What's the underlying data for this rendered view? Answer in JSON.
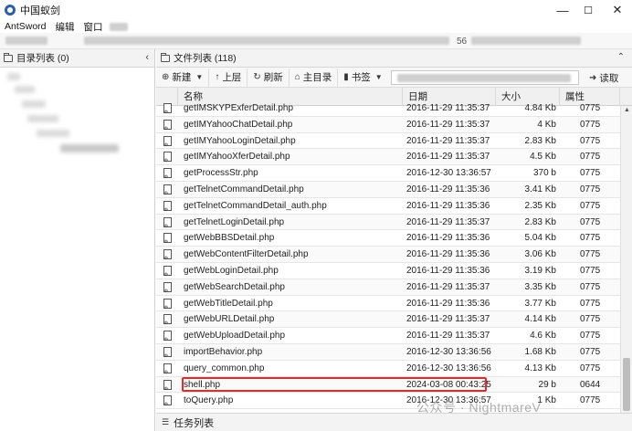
{
  "window": {
    "title": "中国蚁剑",
    "minimize": "—",
    "maximize": "☐",
    "close": "✕"
  },
  "menu": {
    "items": [
      "AntSword",
      "编辑",
      "窗口"
    ]
  },
  "address": {
    "partial_text": "56"
  },
  "left_panel": {
    "title": "目录列表 (0)",
    "collapse": "‹"
  },
  "right_panel": {
    "title": "文件列表 (118)",
    "collapse": "⌃"
  },
  "toolbar": {
    "new_label": "新建",
    "up_label": "上层",
    "refresh_label": "刷新",
    "home_label": "主目录",
    "bookmark_label": "书签",
    "read_label": "读取"
  },
  "table": {
    "headers": {
      "name": "名称",
      "date": "日期",
      "size": "大小",
      "attr": "属性"
    },
    "rows": [
      {
        "name": "getIMSKYPExferDetail.php",
        "date": "2016-11-29 11:35:37",
        "size": "4.84 Kb",
        "attr": "0775"
      },
      {
        "name": "getIMYahooChatDetail.php",
        "date": "2016-11-29 11:35:37",
        "size": "4 Kb",
        "attr": "0775"
      },
      {
        "name": "getIMYahooLoginDetail.php",
        "date": "2016-11-29 11:35:37",
        "size": "2.83 Kb",
        "attr": "0775"
      },
      {
        "name": "getIMYahooXferDetail.php",
        "date": "2016-11-29 11:35:37",
        "size": "4.5 Kb",
        "attr": "0775"
      },
      {
        "name": "getProcessStr.php",
        "date": "2016-12-30 13:36:57",
        "size": "370 b",
        "attr": "0775"
      },
      {
        "name": "getTelnetCommandDetail.php",
        "date": "2016-11-29 11:35:36",
        "size": "3.41 Kb",
        "attr": "0775"
      },
      {
        "name": "getTelnetCommandDetail_auth.php",
        "date": "2016-11-29 11:35:36",
        "size": "2.35 Kb",
        "attr": "0775"
      },
      {
        "name": "getTelnetLoginDetail.php",
        "date": "2016-11-29 11:35:37",
        "size": "2.83 Kb",
        "attr": "0775"
      },
      {
        "name": "getWebBBSDetail.php",
        "date": "2016-11-29 11:35:36",
        "size": "5.04 Kb",
        "attr": "0775"
      },
      {
        "name": "getWebContentFilterDetail.php",
        "date": "2016-11-29 11:35:36",
        "size": "3.06 Kb",
        "attr": "0775"
      },
      {
        "name": "getWebLoginDetail.php",
        "date": "2016-11-29 11:35:36",
        "size": "3.19 Kb",
        "attr": "0775"
      },
      {
        "name": "getWebSearchDetail.php",
        "date": "2016-11-29 11:35:37",
        "size": "3.35 Kb",
        "attr": "0775"
      },
      {
        "name": "getWebTitleDetail.php",
        "date": "2016-11-29 11:35:36",
        "size": "3.77 Kb",
        "attr": "0775"
      },
      {
        "name": "getWebURLDetail.php",
        "date": "2016-11-29 11:35:37",
        "size": "4.14 Kb",
        "attr": "0775"
      },
      {
        "name": "getWebUploadDetail.php",
        "date": "2016-11-29 11:35:37",
        "size": "4.6 Kb",
        "attr": "0775"
      },
      {
        "name": "importBehavior.php",
        "date": "2016-12-30 13:36:56",
        "size": "1.68 Kb",
        "attr": "0775"
      },
      {
        "name": "query_common.php",
        "date": "2016-12-30 13:36:56",
        "size": "4.13 Kb",
        "attr": "0775"
      },
      {
        "name": "shell.php",
        "date": "2024-03-08 00:43:25",
        "size": "29 b",
        "attr": "0644",
        "highlighted": true
      },
      {
        "name": "toQuery.php",
        "date": "2016-12-30 13:36:57",
        "size": "1 Kb",
        "attr": "0775"
      }
    ]
  },
  "taskbar": {
    "label": "任务列表"
  },
  "watermark": {
    "text": "公众号 · NightmareV"
  },
  "colors": {
    "highlight": "#e22b2b",
    "app_icon": "#2d5fa8"
  }
}
